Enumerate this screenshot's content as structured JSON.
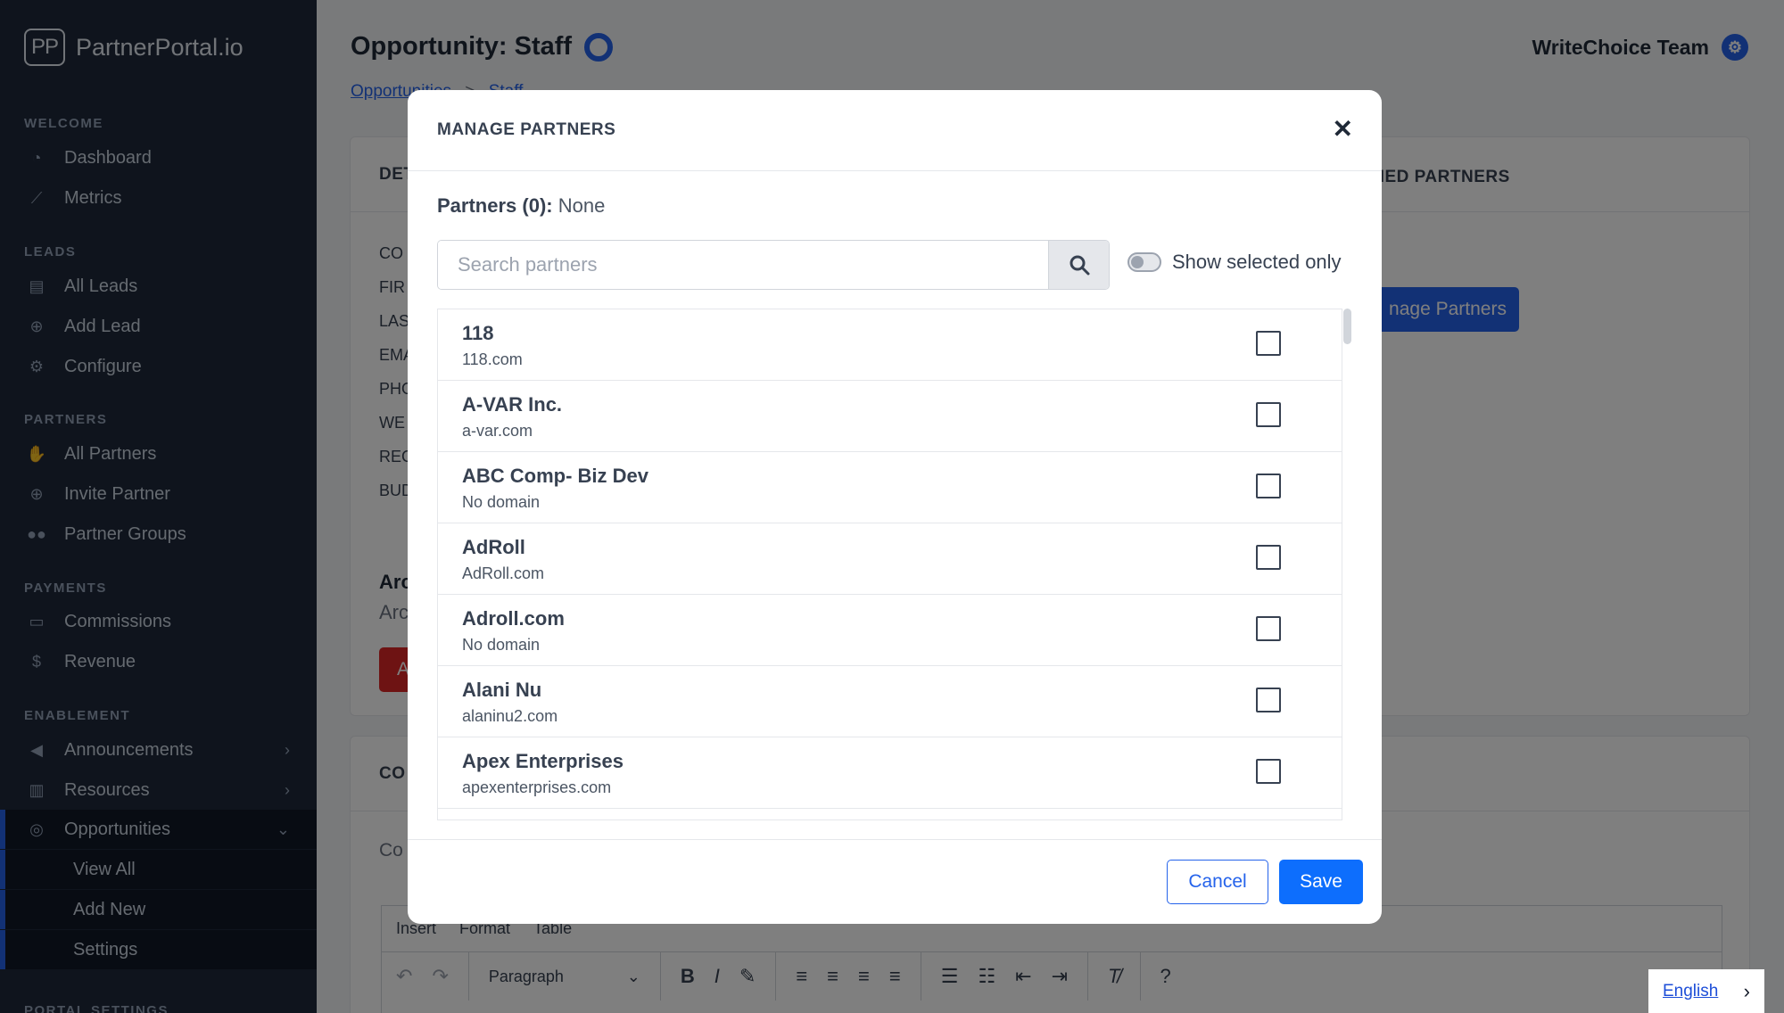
{
  "brand": {
    "mark": "PP",
    "name": "PartnerPortal.io"
  },
  "sidebar": {
    "sections": [
      {
        "title": "WELCOME",
        "items": [
          "Dashboard",
          "Metrics"
        ]
      },
      {
        "title": "LEADS",
        "items": [
          "All Leads",
          "Add Lead",
          "Configure"
        ]
      },
      {
        "title": "PARTNERS",
        "items": [
          "All Partners",
          "Invite Partner",
          "Partner Groups"
        ]
      },
      {
        "title": "PAYMENTS",
        "items": [
          "Commissions",
          "Revenue"
        ]
      },
      {
        "title": "ENABLEMENT",
        "items": [
          "Announcements",
          "Resources",
          "Opportunities"
        ]
      }
    ],
    "opportunities_sub": [
      "View All",
      "Add New",
      "Settings"
    ],
    "bottom_section": "PORTAL SETTINGS"
  },
  "header": {
    "title": "Opportunity: Staff",
    "team": "WriteChoice Team",
    "breadcrumb": [
      "Opportunities",
      ">",
      "Staff"
    ]
  },
  "background": {
    "details_head": "DET",
    "assigned_head": "GNED PARTNERS",
    "field_labels": [
      "CO",
      "FIR",
      "LAS",
      "EMA",
      "PHO",
      "WE",
      "REG",
      "BUD"
    ],
    "archive_title": "Arc",
    "archive_sub": "Arc",
    "red_btn": "A",
    "manage_btn": "nage Partners",
    "comments_head": "CO",
    "comments_sub": "Co",
    "editor_menu": [
      "Insert",
      "Format",
      "Table"
    ],
    "editor_paragraph": "Paragraph"
  },
  "modal": {
    "title": "MANAGE PARTNERS",
    "close": "✕",
    "partners_label": "Partners (0):",
    "partners_value": "None",
    "search_placeholder": "Search partners",
    "toggle_label": "Show selected only",
    "rows": [
      {
        "name": "118",
        "domain": "118.com"
      },
      {
        "name": "A-VAR Inc.",
        "domain": "a-var.com"
      },
      {
        "name": "ABC Comp- Biz Dev",
        "domain": "No domain"
      },
      {
        "name": "AdRoll",
        "domain": "AdRoll.com"
      },
      {
        "name": "Adroll.com",
        "domain": "No domain"
      },
      {
        "name": "Alani Nu",
        "domain": "alaninu2.com"
      },
      {
        "name": "Apex Enterprises",
        "domain": "apexenterprises.com"
      }
    ],
    "cancel": "Cancel",
    "save": "Save"
  },
  "language": "English",
  "colors": {
    "sidebar": "#1e293b",
    "accent": "#2563eb",
    "danger": "#dc2626"
  }
}
